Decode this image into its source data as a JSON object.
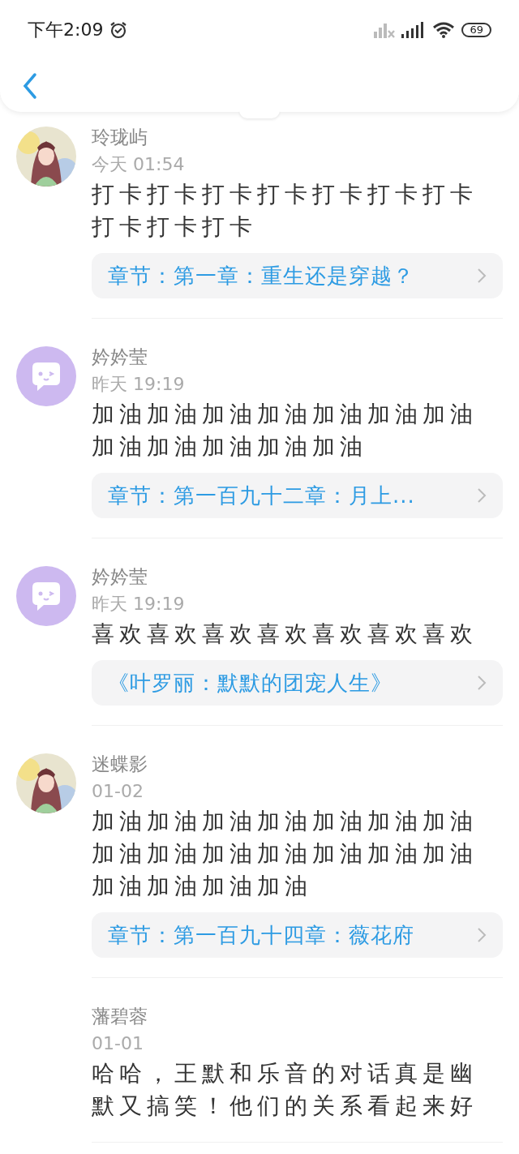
{
  "status_bar": {
    "time": "下午2:09",
    "battery": "69"
  },
  "comments": [
    {
      "kind": "picture",
      "name": "玲珑屿",
      "time": "今天 01:54",
      "text": "打卡打卡打卡打卡打卡打卡打卡打卡打卡打卡",
      "link": "章节：第一章：重生还是穿越？"
    },
    {
      "kind": "icon",
      "name": "妗妗莹",
      "time": "昨天 19:19",
      "text": "加油加油加油加油加油加油加油加油加油加油加油加油",
      "link": "章节：第一百九十二章：月上..."
    },
    {
      "kind": "icon",
      "name": "妗妗莹",
      "time": "昨天 19:19",
      "text": "喜欢喜欢喜欢喜欢喜欢喜欢喜欢",
      "link": "《叶罗丽：默默的团宠人生》"
    },
    {
      "kind": "picture",
      "name": "迷蝶影",
      "time": "01-02",
      "text": "加油加油加油加油加油加油加油加油加油加油加油加油加油加油加油加油加油加油",
      "link": "章节：第一百九十四章：薇花府"
    },
    {
      "kind": "plain",
      "name": "藩碧蓉",
      "time": "01-01",
      "text": "哈哈，王默和乐音的对话真是幽默又搞笑！他们的关系看起来好"
    }
  ]
}
